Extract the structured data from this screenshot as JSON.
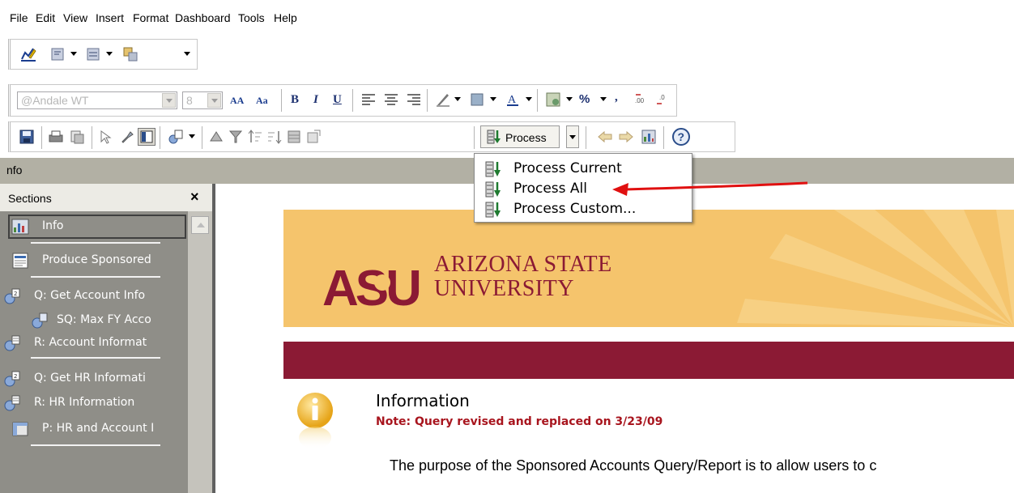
{
  "menubar": {
    "items": [
      "File",
      "Edit",
      "View",
      "Insert",
      "Format",
      "Dashboard",
      "Tools",
      "Help"
    ]
  },
  "format_toolbar": {
    "font_name": "@Andale WT",
    "font_size": "8",
    "bold": "B",
    "italic": "I",
    "underline": "U",
    "percent": "%",
    "comma": ","
  },
  "standard_toolbar": {
    "process_label": "Process"
  },
  "process_menu": {
    "items": [
      "Process Current",
      "Process All",
      "Process Custom..."
    ]
  },
  "section_title": "nfo",
  "sections_panel": {
    "title": "Sections",
    "close": "×",
    "items": [
      {
        "label": "Info",
        "icon": "dashboard-icon"
      },
      {
        "label": "Produce Sponsored",
        "icon": "report-icon"
      },
      {
        "label": "Q: Get Account Info",
        "icon": "query-icon"
      },
      {
        "label": "SQ: Max FY Acco",
        "icon": "subquery-icon"
      },
      {
        "label": "R: Account Informat",
        "icon": "results-icon"
      },
      {
        "label": "Q: Get HR Informati",
        "icon": "query-icon"
      },
      {
        "label": "R: HR Information",
        "icon": "results-icon"
      },
      {
        "label": "P: HR and Account I",
        "icon": "pivot-icon"
      }
    ]
  },
  "content": {
    "university_line1": "ARIZONA STATE",
    "university_line2": "UNIVERSITY",
    "logo_text": "ASU",
    "info_title": "Information",
    "info_note": "Note:  Query revised and replaced on 3/23/09",
    "info_body": "The purpose of the Sponsored Accounts Query/Report is to allow users to c"
  },
  "colors": {
    "asu_gold": "#f5c46c",
    "asu_maroon": "#8b1a34",
    "note_red": "#a8151e",
    "annotation_arrow": "#e01010"
  }
}
